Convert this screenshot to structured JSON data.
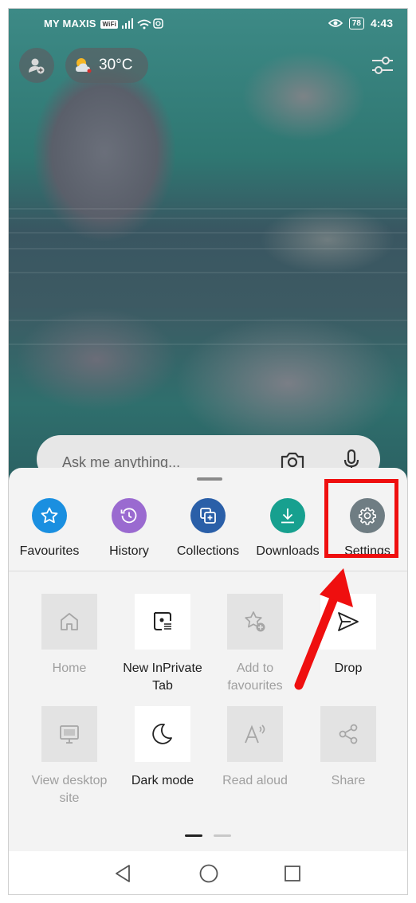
{
  "status_bar": {
    "carrier": "MY MAXIS",
    "wifi_tag": "WiFi",
    "battery": "78",
    "time": "4:43"
  },
  "weather": {
    "temperature": "30°C",
    "icon": "partly-cloudy-icon"
  },
  "search": {
    "placeholder": "Ask me anything..."
  },
  "menu": {
    "top_items": [
      {
        "label": "Favourites",
        "icon": "star-icon",
        "color": "#1a8fe0"
      },
      {
        "label": "History",
        "icon": "history-icon",
        "color": "#9a6ad0"
      },
      {
        "label": "Collections",
        "icon": "collections-icon",
        "color": "#2a5fa8"
      },
      {
        "label": "Downloads",
        "icon": "download-icon",
        "color": "#17a08f"
      },
      {
        "label": "Settings",
        "icon": "gear-icon",
        "color": "#6f7d83"
      }
    ],
    "grid_items": [
      {
        "label": "Home",
        "icon": "home-icon",
        "enabled": false
      },
      {
        "label": "New InPrivate Tab",
        "icon": "inprivate-tab-icon",
        "enabled": true
      },
      {
        "label": "Add to favourites",
        "icon": "star-add-icon",
        "enabled": false
      },
      {
        "label": "Drop",
        "icon": "send-icon",
        "enabled": true
      },
      {
        "label": "View desktop site",
        "icon": "desktop-icon",
        "enabled": false
      },
      {
        "label": "Dark mode",
        "icon": "moon-icon",
        "enabled": true
      },
      {
        "label": "Read aloud",
        "icon": "read-aloud-icon",
        "enabled": false
      },
      {
        "label": "Share",
        "icon": "share-icon",
        "enabled": false
      }
    ],
    "page_indicator": {
      "current": 1,
      "total": 2
    }
  },
  "annotation": {
    "highlight_color": "#ef0f0f",
    "target": "Settings"
  }
}
